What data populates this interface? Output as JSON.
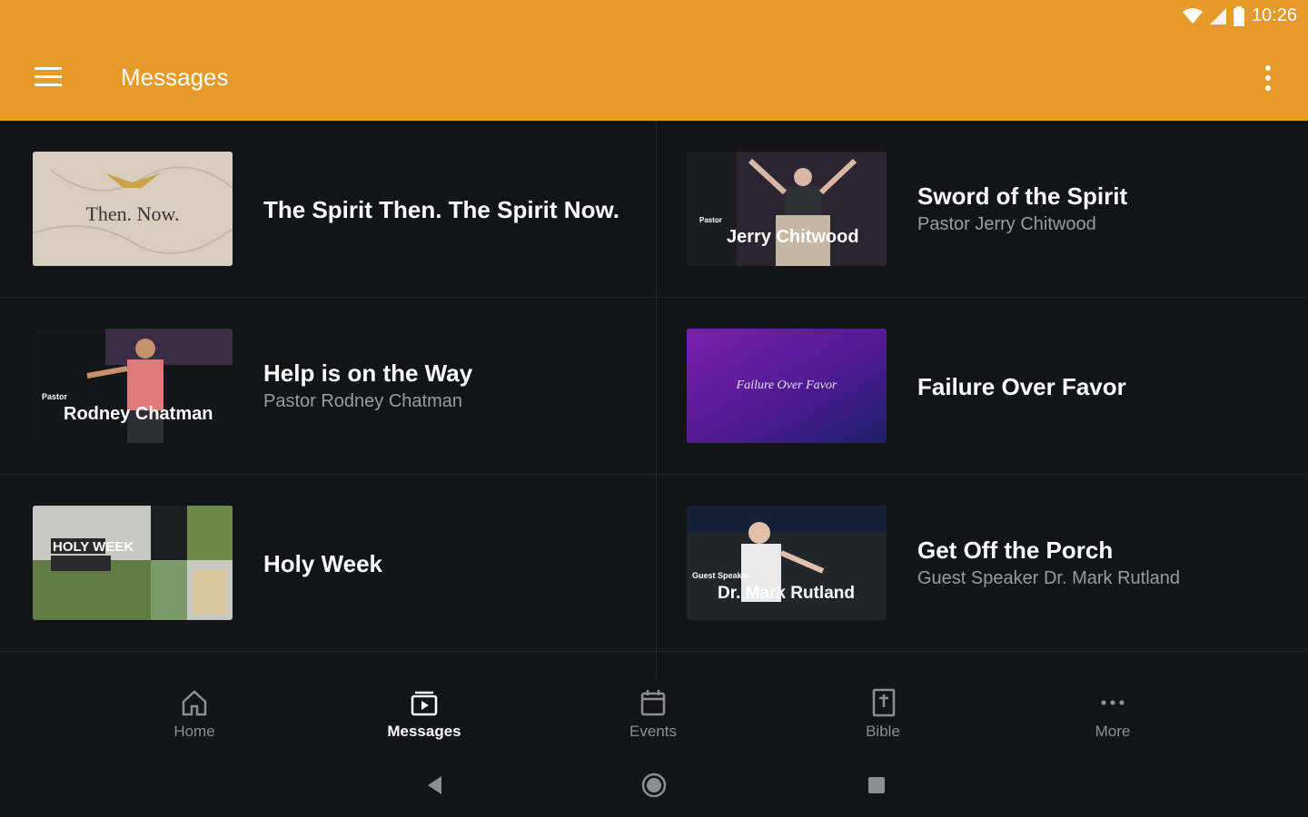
{
  "status": {
    "time": "10:26"
  },
  "appbar": {
    "title": "Messages"
  },
  "messages": [
    {
      "title": "The Spirit Then. The Spirit Now.",
      "subtitle": "",
      "thumb_text": "Then. Now.",
      "thumb_small": "",
      "thumb_colors": [
        "#d9cfbe",
        "#bdb29f"
      ]
    },
    {
      "title": "Sword of the Spirit",
      "subtitle": "Pastor Jerry Chitwood",
      "thumb_text": "Jerry Chitwood",
      "thumb_small": "Pastor",
      "thumb_colors": [
        "#1b1c22",
        "#3b2f2a"
      ]
    },
    {
      "title": "Help is on the Way",
      "subtitle": "Pastor Rodney Chatman",
      "thumb_text": "Rodney Chatman",
      "thumb_small": "Pastor",
      "thumb_colors": [
        "#2a2430",
        "#15161a"
      ]
    },
    {
      "title": "Failure Over Favor",
      "subtitle": "",
      "thumb_text": "Failure Over Favor",
      "thumb_small": "",
      "thumb_colors": [
        "#6b1fa3",
        "#1d1f6e"
      ]
    },
    {
      "title": "Holy Week",
      "subtitle": "",
      "thumb_text": "HOLY WEEK",
      "thumb_small": "",
      "thumb_colors": [
        "#c7c9c2",
        "#5a7a3a"
      ]
    },
    {
      "title": "Get Off the Porch",
      "subtitle": "Guest Speaker Dr. Mark Rutland",
      "thumb_text": "Dr. Mark Rutland",
      "thumb_small": "Guest Speaker",
      "thumb_colors": [
        "#14203a",
        "#2c2c33"
      ]
    }
  ],
  "nav": {
    "home": "Home",
    "messages": "Messages",
    "events": "Events",
    "bible": "Bible",
    "more": "More"
  },
  "colors": {
    "accent": "#E59A2A",
    "background": "#131417",
    "text_secondary": "#9a9b9f"
  }
}
